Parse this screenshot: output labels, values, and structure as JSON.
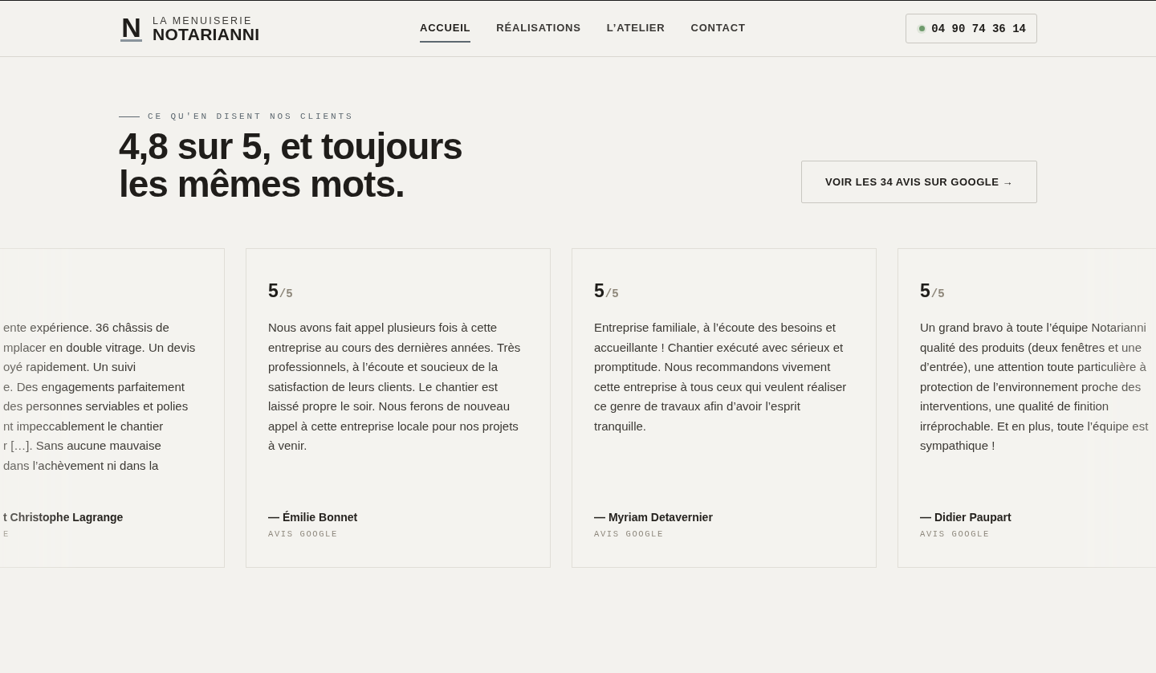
{
  "header": {
    "logo": {
      "mark": "N",
      "tagline": "LA MENUISERIE",
      "name": "NOTARIANNI"
    },
    "nav": [
      {
        "label": "ACCUEIL",
        "selected": true
      },
      {
        "label": "RÉALISATIONS",
        "selected": false
      },
      {
        "label": "L’ATELIER",
        "selected": false
      },
      {
        "label": "CONTACT",
        "selected": false
      }
    ],
    "phone": "04 90 74 36 14"
  },
  "testimonials": {
    "eyebrow": "CE QU'EN DISENT NOS CLIENTS",
    "title": "4,8 sur 5, et toujours les mêmes mots.",
    "cta": "VOIR LES 34 AVIS SUR GOOGLE →",
    "reviews": [
      {
        "kind": "cut_left",
        "lines": [
          "ente expérience. 36 châssis de",
          "mplacer en double vitrage. Un devis",
          "oyé rapidement. Un suivi",
          "e. Des engagements parfaitement",
          "des personnes serviables et polies",
          "nt impeccablement le chantier",
          "r […]. Sans aucune mauvaise",
          "dans l’achèvement ni dans la"
        ],
        "author": "t Christophe Lagrange",
        "source": "E"
      },
      {
        "kind": "full",
        "score": "5",
        "scale": "/5",
        "text": "Nous avons fait appel plusieurs fois à cette entreprise au cours des dernières années. Très professionnels, à l’écoute et soucieux de la satisfaction de leurs clients. Le chantier est laissé propre le soir. Nous ferons de nouveau appel à cette entreprise locale pour nos projets à venir.",
        "author": "— Émilie Bonnet",
        "source": "AVIS GOOGLE"
      },
      {
        "kind": "full",
        "score": "5",
        "scale": "/5",
        "text": "Entreprise familiale, à l’écoute des besoins et accueillante ! Chantier exécuté avec sérieux et promptitude. Nous recommandons vivement cette entreprise à tous ceux qui veulent réaliser ce genre de travaux afin d’avoir l’esprit tranquille.",
        "author": "— Myriam Detavernier",
        "source": "AVIS GOOGLE"
      },
      {
        "kind": "cut_right",
        "score": "5",
        "scale": "/5",
        "lines": [
          "Un grand bravo à toute l’équipe Notarianni",
          "qualité des produits (deux fenêtres et une",
          "d’entrée), une attention toute particulière à",
          "protection de l’environnement proche des",
          "interventions, une qualité de finition",
          "irréprochable. Et en plus, toute l’équipe est",
          "sympathique !"
        ],
        "author": "— Didier Paupart",
        "source": "AVIS GOOGLE"
      }
    ]
  }
}
